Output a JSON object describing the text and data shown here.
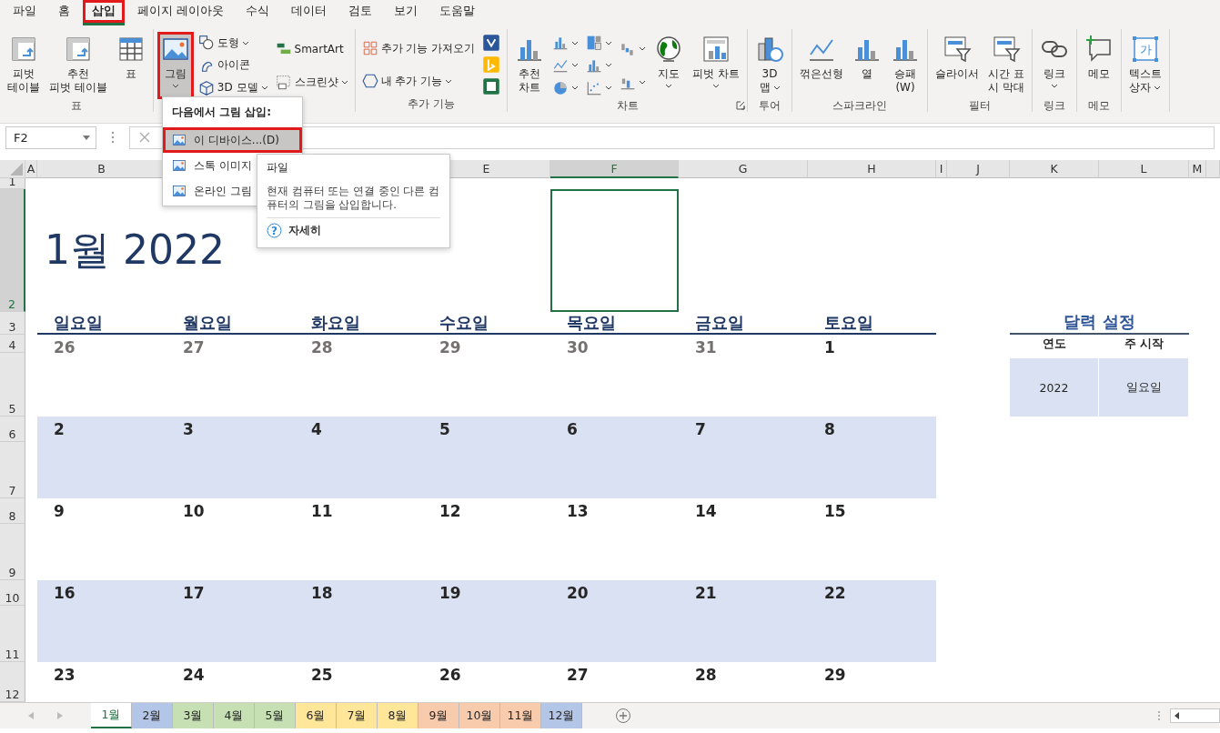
{
  "menu_tabs": [
    {
      "label": "파일",
      "selected": false,
      "highlighted": false
    },
    {
      "label": "홈",
      "selected": false,
      "highlighted": false
    },
    {
      "label": "삽입",
      "selected": true,
      "highlighted": true
    },
    {
      "label": "페이지 레이아웃",
      "selected": false,
      "highlighted": false
    },
    {
      "label": "수식",
      "selected": false,
      "highlighted": false
    },
    {
      "label": "데이터",
      "selected": false,
      "highlighted": false
    },
    {
      "label": "검토",
      "selected": false,
      "highlighted": false
    },
    {
      "label": "보기",
      "selected": false,
      "highlighted": false
    },
    {
      "label": "도움말",
      "selected": false,
      "highlighted": false
    }
  ],
  "ribbon_groups": [
    {
      "label": "표",
      "buttons": [
        {
          "kind": "large",
          "lines": [
            "피벗",
            "테이블"
          ],
          "pressed": false,
          "highlighted": false
        },
        {
          "kind": "large",
          "lines": [
            "추천",
            "피벗 테이블"
          ],
          "pressed": false,
          "highlighted": false
        },
        {
          "kind": "large",
          "lines": [
            "표"
          ],
          "pressed": false,
          "highlighted": false
        }
      ]
    },
    {
      "buttons": [
        {
          "kind": "large",
          "lines": [
            "그림"
          ],
          "dropdown": true,
          "pressed": true,
          "highlighted": true
        },
        {
          "kind": "small",
          "label": "도형",
          "dropdown": true,
          "pressed": false,
          "highlighted": false
        },
        {
          "kind": "small",
          "label": "아이콘",
          "pressed": false,
          "highlighted": false
        },
        {
          "kind": "small",
          "label": "3D 모델",
          "dropdown": true,
          "pressed": false,
          "highlighted": false
        },
        {
          "kind": "small",
          "label": "SmartArt",
          "pressed": false,
          "highlighted": false
        },
        {
          "kind": "small",
          "label": "스크린샷",
          "dropdown": true,
          "pressed": false,
          "highlighted": false
        }
      ]
    },
    {
      "label": "추가 기능",
      "buttons": [
        {
          "kind": "small",
          "label": "추가 기능 가져오기",
          "pressed": false,
          "highlighted": false
        },
        {
          "kind": "small",
          "label": "내 추가 기능",
          "dropdown": true,
          "pressed": false,
          "highlighted": false
        },
        {
          "kind": "tile",
          "pressed": false,
          "highlighted": false
        },
        {
          "kind": "tile",
          "pressed": false,
          "highlighted": false
        },
        {
          "kind": "tile",
          "pressed": false,
          "highlighted": false
        }
      ]
    },
    {
      "label": "차트",
      "launcher": true,
      "buttons": [
        {
          "kind": "large",
          "lines": [
            "추천",
            "차트"
          ],
          "pressed": false,
          "highlighted": false
        },
        {
          "kind": "icon",
          "dropdown": true,
          "pressed": false,
          "highlighted": false
        },
        {
          "kind": "icon",
          "dropdown": true,
          "pressed": false,
          "highlighted": false
        },
        {
          "kind": "icon",
          "dropdown": true,
          "pressed": false,
          "highlighted": false
        },
        {
          "kind": "icon",
          "dropdown": true,
          "pressed": false,
          "highlighted": false
        },
        {
          "kind": "icon",
          "dropdown": true,
          "pressed": false,
          "highlighted": false
        },
        {
          "kind": "icon",
          "dropdown": true,
          "pressed": false,
          "highlighted": false
        },
        {
          "kind": "icon",
          "dropdown": true,
          "pressed": false,
          "highlighted": false
        },
        {
          "kind": "icon",
          "dropdown": true,
          "pressed": false,
          "highlighted": false
        },
        {
          "kind": "large",
          "lines": [
            "지도"
          ],
          "dropdown": true,
          "pressed": false,
          "highlighted": false
        },
        {
          "kind": "large",
          "lines": [
            "피벗 차트"
          ],
          "dropdown": true,
          "pressed": false,
          "highlighted": false
        }
      ]
    },
    {
      "label": "투어",
      "buttons": [
        {
          "kind": "large",
          "lines": [
            "3D",
            "맵"
          ],
          "dropdown": true,
          "pressed": false,
          "highlighted": false
        }
      ]
    },
    {
      "label": "스파크라인",
      "buttons": [
        {
          "kind": "large",
          "lines": [
            "꺾은선형"
          ],
          "pressed": false,
          "highlighted": false
        },
        {
          "kind": "large",
          "lines": [
            "열"
          ],
          "pressed": false,
          "highlighted": false
        },
        {
          "kind": "large",
          "lines": [
            "승패",
            "(W)"
          ],
          "pressed": false,
          "highlighted": false
        }
      ]
    },
    {
      "label": "필터",
      "buttons": [
        {
          "kind": "large",
          "lines": [
            "슬라이서"
          ],
          "pressed": false,
          "highlighted": false
        },
        {
          "kind": "large",
          "lines": [
            "시간 표",
            "시 막대"
          ],
          "pressed": false,
          "highlighted": false
        }
      ]
    },
    {
      "label": "링크",
      "buttons": [
        {
          "kind": "large",
          "lines": [
            "링크"
          ],
          "dropdown": true,
          "pressed": false,
          "highlighted": false
        }
      ]
    },
    {
      "label": "메모",
      "buttons": [
        {
          "kind": "large",
          "lines": [
            "메모"
          ],
          "pressed": false,
          "highlighted": false
        }
      ]
    },
    {
      "buttons": [
        {
          "kind": "large",
          "lines": [
            "텍스트",
            "상자"
          ],
          "icon_text": "가",
          "dropdown": true,
          "pressed": false,
          "highlighted": false
        }
      ]
    }
  ],
  "picture_menu": {
    "heading": "다음에서 그림 삽입:",
    "items": [
      {
        "label": "이 디바이스...(D)",
        "hovered": true,
        "highlighted": true
      },
      {
        "label": "스톡 이미지",
        "hovered": false,
        "highlighted": false
      },
      {
        "label": "온라인 그림",
        "hovered": false,
        "highlighted": false
      }
    ]
  },
  "tooltip": {
    "title": "파일",
    "description": "현재 컴퓨터 또는 연결 중인 다른 컴퓨터의 그림을 삽입합니다.",
    "help_glyph": "?",
    "link": "자세히"
  },
  "formula_bar": {
    "name_box": "F2"
  },
  "sheet": {
    "columns": [
      {
        "label": "A",
        "selected": false
      },
      {
        "label": "B",
        "selected": false
      },
      null,
      null,
      {
        "label": "E",
        "selected": false
      },
      {
        "label": "F",
        "selected": true
      },
      {
        "label": "G",
        "selected": false
      },
      {
        "label": "H",
        "selected": false
      },
      {
        "label": "I",
        "selected": false
      },
      {
        "label": "J",
        "selected": false
      },
      {
        "label": "K",
        "selected": false
      },
      {
        "label": "L",
        "selected": false
      },
      {
        "label": "M",
        "selected": false
      }
    ],
    "rows": [
      {
        "label": "1",
        "selected": false
      },
      {
        "label": "2",
        "selected": true
      },
      {
        "label": "3",
        "selected": false
      },
      {
        "label": "4",
        "selected": false
      },
      {
        "label": "5",
        "selected": false
      },
      {
        "label": "6",
        "selected": false
      },
      {
        "label": "7",
        "selected": false
      },
      {
        "label": "8",
        "selected": false
      },
      {
        "label": "9",
        "selected": false
      },
      {
        "label": "10",
        "selected": false
      },
      {
        "label": "11",
        "selected": false
      },
      {
        "label": "12",
        "selected": false
      }
    ],
    "title": "1월 2022",
    "weekdays": [
      "일요일",
      "월요일",
      "화요일",
      "수요일",
      "목요일",
      "금요일",
      "토요일"
    ],
    "weeks": [
      {
        "shaded": false,
        "days": [
          {
            "label": "26",
            "other_month": true
          },
          {
            "label": "27",
            "other_month": true
          },
          {
            "label": "28",
            "other_month": true
          },
          {
            "label": "29",
            "other_month": true
          },
          {
            "label": "30",
            "other_month": true
          },
          {
            "label": "31",
            "other_month": true
          },
          {
            "label": "1",
            "other_month": false
          }
        ]
      },
      {
        "shaded": true,
        "days": [
          {
            "label": "2",
            "other_month": false
          },
          {
            "label": "3",
            "other_month": false
          },
          {
            "label": "4",
            "other_month": false
          },
          {
            "label": "5",
            "other_month": false
          },
          {
            "label": "6",
            "other_month": false
          },
          {
            "label": "7",
            "other_month": false
          },
          {
            "label": "8",
            "other_month": false
          }
        ]
      },
      {
        "shaded": false,
        "days": [
          {
            "label": "9",
            "other_month": false
          },
          {
            "label": "10",
            "other_month": false
          },
          {
            "label": "11",
            "other_month": false
          },
          {
            "label": "12",
            "other_month": false
          },
          {
            "label": "13",
            "other_month": false
          },
          {
            "label": "14",
            "other_month": false
          },
          {
            "label": "15",
            "other_month": false
          }
        ]
      },
      {
        "shaded": true,
        "days": [
          {
            "label": "16",
            "other_month": false
          },
          {
            "label": "17",
            "other_month": false
          },
          {
            "label": "18",
            "other_month": false
          },
          {
            "label": "19",
            "other_month": false
          },
          {
            "label": "20",
            "other_month": false
          },
          {
            "label": "21",
            "other_month": false
          },
          {
            "label": "22",
            "other_month": false
          }
        ]
      },
      {
        "shaded": false,
        "days": [
          {
            "label": "23",
            "other_month": false
          },
          {
            "label": "24",
            "other_month": false
          },
          {
            "label": "25",
            "other_month": false
          },
          {
            "label": "26",
            "other_month": false
          },
          {
            "label": "27",
            "other_month": false
          },
          {
            "label": "28",
            "other_month": false
          },
          {
            "label": "29",
            "other_month": false
          }
        ]
      }
    ],
    "settings": {
      "title": "달력 설정",
      "headers": [
        "연도",
        "주 시작"
      ],
      "values": [
        "2022",
        "일요일"
      ]
    }
  },
  "sheet_tabs": [
    {
      "label": "1월",
      "selected": true
    },
    {
      "label": "2월",
      "selected": false,
      "color": "#b4c6e7"
    },
    {
      "label": "3월",
      "selected": false,
      "color": "#c6e0b4"
    },
    {
      "label": "4월",
      "selected": false,
      "color": "#c6e0b4"
    },
    {
      "label": "5월",
      "selected": false,
      "color": "#c6e0b4"
    },
    {
      "label": "6월",
      "selected": false,
      "color": "#ffe699"
    },
    {
      "label": "7월",
      "selected": false,
      "color": "#ffe699"
    },
    {
      "label": "8월",
      "selected": false,
      "color": "#ffe699"
    },
    {
      "label": "9월",
      "selected": false,
      "color": "#f8cbad"
    },
    {
      "label": "10월",
      "selected": false,
      "color": "#f8cbad"
    },
    {
      "label": "11월",
      "selected": false,
      "color": "#f8cbad"
    },
    {
      "label": "12월",
      "selected": false,
      "color": "#b4c6e7"
    }
  ]
}
